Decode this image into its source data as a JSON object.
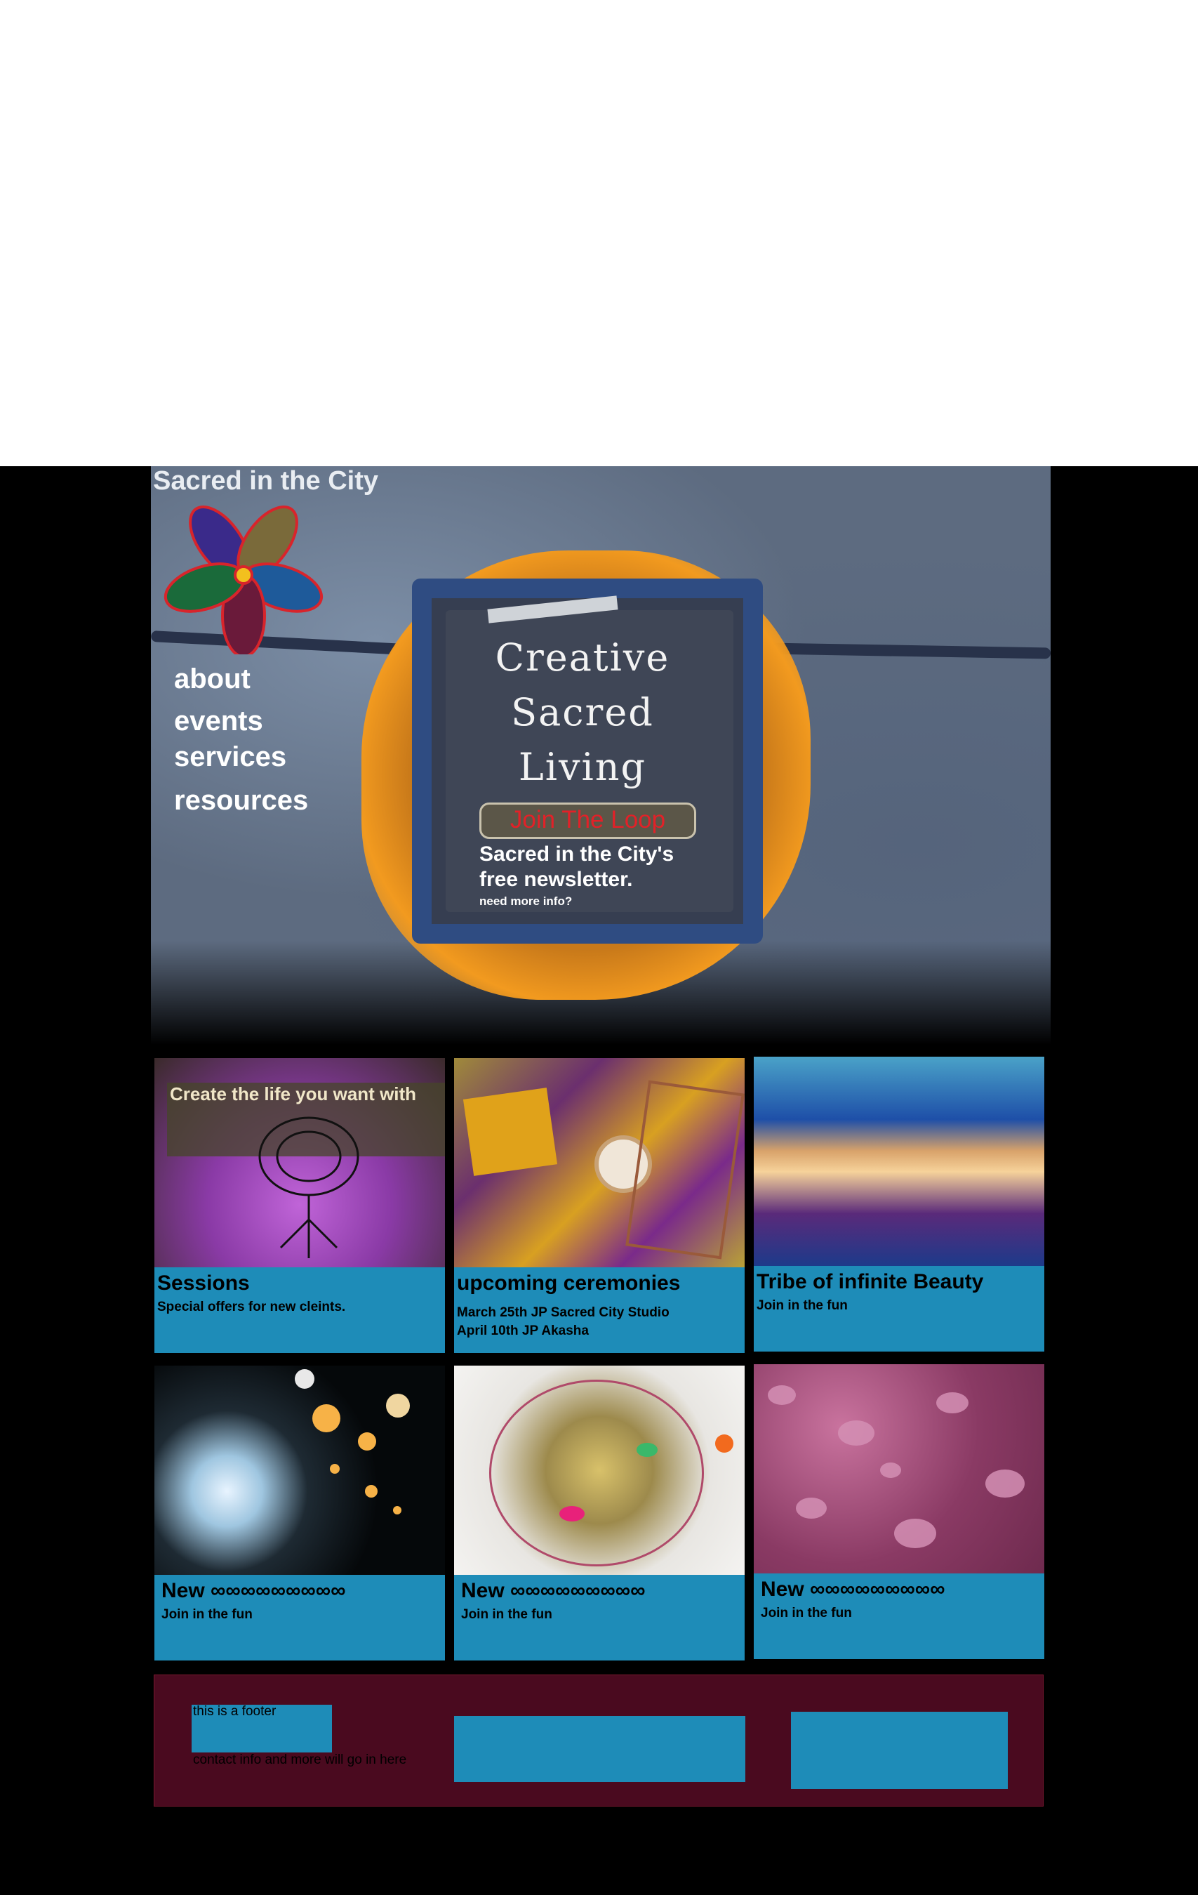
{
  "site": {
    "title": "Sacred in the City",
    "logo_icon": "flower-logo-icon"
  },
  "nav": {
    "items": [
      {
        "label": "about"
      },
      {
        "label": "events"
      },
      {
        "label": "services"
      },
      {
        "label": "resources"
      }
    ]
  },
  "hero": {
    "headline_lines": [
      "Creative",
      "Sacred",
      "Living"
    ],
    "cta_label": "Join The Loop",
    "newsletter_line1": "Sacred in the City's",
    "newsletter_line2": "free newsletter.",
    "more_info": "need more info?"
  },
  "cards": [
    {
      "title": "Sessions",
      "subtitle_lines": [
        "Special offers for new cleints."
      ],
      "image_text": "Create the life you want with"
    },
    {
      "title": "upcoming ceremonies",
      "subtitle_lines": [
        "March 25th JP Sacred City Studio",
        "April 10th JP Akasha"
      ]
    },
    {
      "title": "Tribe of infinite Beauty",
      "subtitle_lines": [
        "Join in the fun"
      ]
    },
    {
      "title": "New ∞∞∞∞∞∞∞∞∞",
      "subtitle_lines": [
        "Join in the fun"
      ]
    },
    {
      "title": "New ∞∞∞∞∞∞∞∞∞",
      "subtitle_lines": [
        "Join in the fun"
      ]
    },
    {
      "title": "New ∞∞∞∞∞∞∞∞∞",
      "subtitle_lines": [
        "Join in the fun"
      ]
    }
  ],
  "footer": {
    "label": "this is a footer",
    "contact": "contact info and more will go in here"
  },
  "colors": {
    "card_blue": "#1e8cb8",
    "footer_maroon": "#4a0a1f",
    "cta_red": "#e22128",
    "hero_orange": "#f29a1f"
  }
}
